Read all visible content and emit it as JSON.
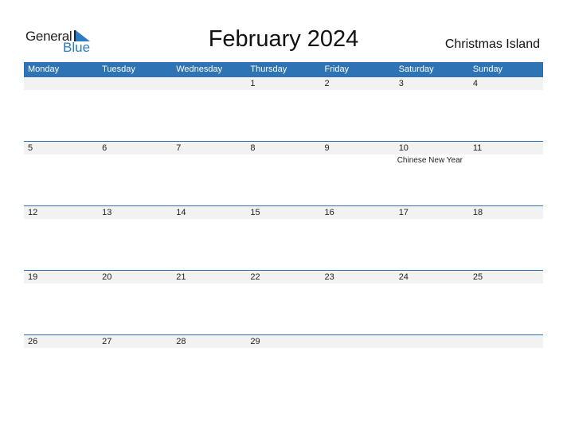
{
  "logo": {
    "general": "General",
    "blue": "Blue"
  },
  "title": "February 2024",
  "country": "Christmas Island",
  "colors": {
    "accent": "#2E73B3",
    "strip": "#F2F2F2"
  },
  "weekdays": [
    "Monday",
    "Tuesday",
    "Wednesday",
    "Thursday",
    "Friday",
    "Saturday",
    "Sunday"
  ],
  "weeks": [
    [
      "",
      "",
      "",
      "1",
      "2",
      "3",
      "4"
    ],
    [
      "5",
      "6",
      "7",
      "8",
      "9",
      "10",
      "11"
    ],
    [
      "12",
      "13",
      "14",
      "15",
      "16",
      "17",
      "18"
    ],
    [
      "19",
      "20",
      "21",
      "22",
      "23",
      "24",
      "25"
    ],
    [
      "26",
      "27",
      "28",
      "29",
      "",
      "",
      ""
    ]
  ],
  "events": [
    {
      "week": 1,
      "day_index": 5,
      "label": "Chinese New Year"
    }
  ]
}
